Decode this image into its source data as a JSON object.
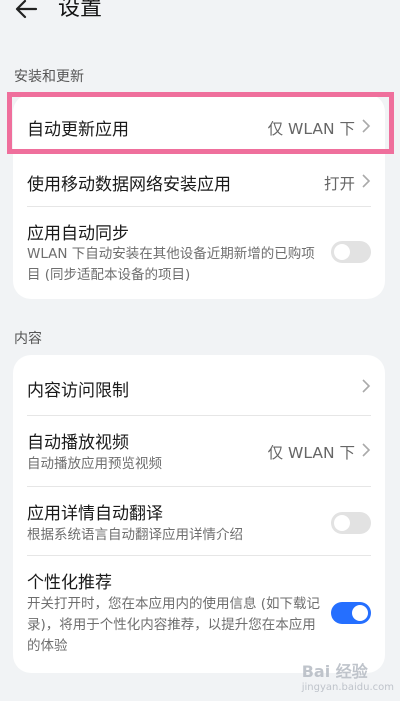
{
  "header": {
    "title": "设置"
  },
  "sections": [
    {
      "title": "安装和更新",
      "rows": [
        {
          "title": "自动更新应用",
          "value": "仅 WLAN 下"
        },
        {
          "title": "使用移动数据网络安装应用",
          "value": "打开"
        },
        {
          "title": "应用自动同步",
          "subtitle": "WLAN 下自动安装在其他设备近期新增的已购项目 (同步适配本设备的项目)",
          "toggle": false
        }
      ]
    },
    {
      "title": "内容",
      "rows": [
        {
          "title": "内容访问限制"
        },
        {
          "title": "自动播放视频",
          "subtitle": "自动播放应用预览视频",
          "value": "仅 WLAN 下"
        },
        {
          "title": "应用详情自动翻译",
          "subtitle": "根据系统语言自动翻译应用详情介绍",
          "toggle": false
        },
        {
          "title": "个性化推荐",
          "subtitle": "开关打开时，您在本应用内的使用信息 (如下载记录)，将用于个性化内容推荐，以提升您在本应用的体验",
          "toggle": true
        }
      ]
    }
  ],
  "colors": {
    "accent": "#256fff",
    "highlight": "#ef6f9c"
  },
  "watermark": {
    "text": "Bai 经验",
    "sub": "jingyan.baidu.com"
  }
}
